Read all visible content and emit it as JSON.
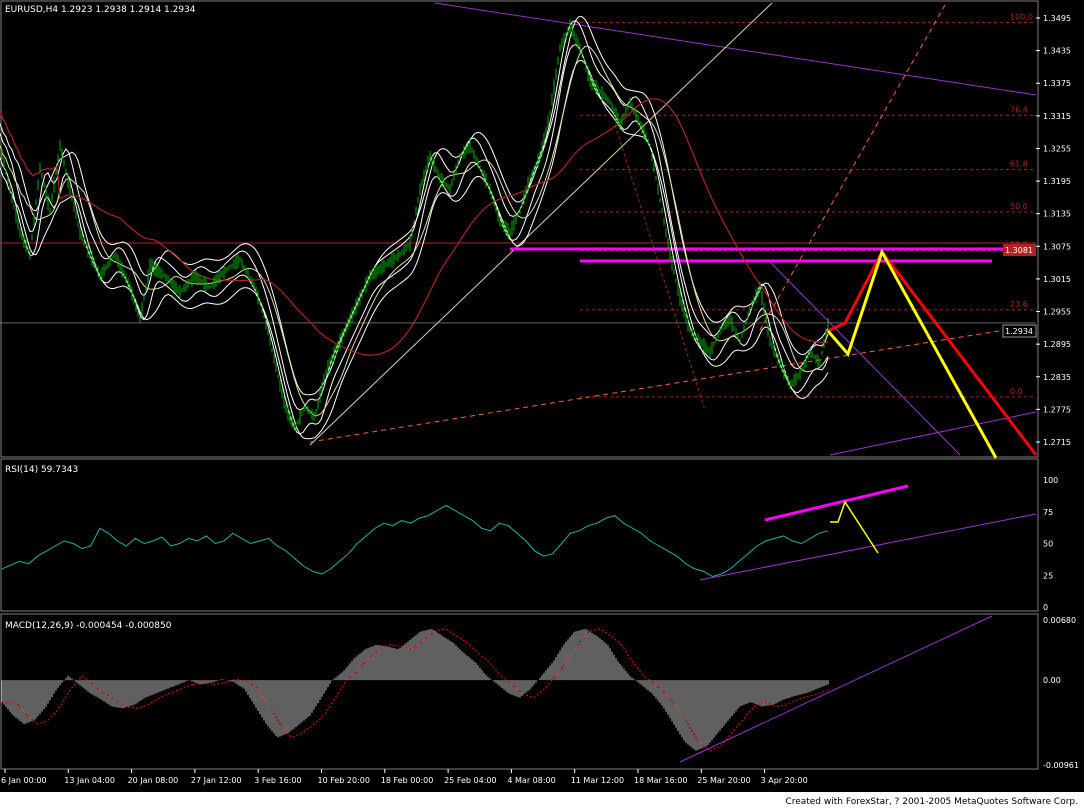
{
  "chart_title": "EURUSD,H4  1.2923 1.2938 1.2914 1.2934",
  "rsi_label": "RSI(14)  59.7343",
  "macd_label": "MACD(12,26,9)  -0.000454  -0.000850",
  "footer": "Created with ForexStar, ? 2001-2005 MetaQuotes Software Corp.",
  "current_price_label": "1.2934",
  "resistance_price_label": "1.3081",
  "colors": {
    "background": "#000000",
    "price_bars": "#00b400",
    "bands": "#ffffff",
    "ma_red": "#b22222",
    "rsi_line": "#20b2aa",
    "magenta": "#ff00ff",
    "trend_purple": "#9932cc",
    "forecast_red": "#ff0000",
    "forecast_yellow": "#ffff00",
    "fib": "#b22222",
    "macd_hist": "#c0c0c0",
    "macd_signal": "#ff0000"
  },
  "chart_data": [
    {
      "type": "line",
      "panel": "price",
      "symbol": "EURUSD",
      "timeframe": "H4",
      "ohlc_last": {
        "open": 1.2923,
        "high": 1.2938,
        "low": 1.2914,
        "close": 1.2934
      },
      "ylim": [
        1.2715,
        1.3495
      ],
      "y_ticks": [
        "1.3495",
        "1.3435",
        "1.3375",
        "1.3315",
        "1.3255",
        "1.3195",
        "1.3135",
        "1.3075",
        "1.3015",
        "1.2955",
        "1.2895",
        "1.2835",
        "1.2775",
        "1.2715"
      ],
      "x_ticks": [
        "6 Jan 00:00",
        "13 Jan 04:00",
        "20 Jan 08:00",
        "27 Jan 12:00",
        "3 Feb 16:00",
        "10 Feb 20:00",
        "18 Feb 00:00",
        "25 Feb 04:00",
        "4 Mar 08:00",
        "11 Mar 12:00",
        "18 Mar 16:00",
        "25 Mar 20:00",
        "3 Apr 20:00"
      ],
      "close_path": [
        [
          0,
          1.326
        ],
        [
          10,
          1.318
        ],
        [
          20,
          1.31
        ],
        [
          30,
          1.306
        ],
        [
          40,
          1.322
        ],
        [
          50,
          1.314
        ],
        [
          60,
          1.326
        ],
        [
          70,
          1.318
        ],
        [
          80,
          1.31
        ],
        [
          90,
          1.306
        ],
        [
          100,
          1.302
        ],
        [
          115,
          1.306
        ],
        [
          130,
          1.3
        ],
        [
          140,
          1.294
        ],
        [
          150,
          1.304
        ],
        [
          165,
          1.302
        ],
        [
          180,
          1.299
        ],
        [
          195,
          1.302
        ],
        [
          210,
          1.3
        ],
        [
          225,
          1.303
        ],
        [
          240,
          1.305
        ],
        [
          255,
          1.3
        ],
        [
          265,
          1.294
        ],
        [
          275,
          1.286
        ],
        [
          285,
          1.278
        ],
        [
          295,
          1.274
        ],
        [
          305,
          1.278
        ],
        [
          315,
          1.276
        ],
        [
          325,
          1.284
        ],
        [
          340,
          1.29
        ],
        [
          355,
          1.296
        ],
        [
          370,
          1.302
        ],
        [
          385,
          1.304
        ],
        [
          400,
          1.306
        ],
        [
          410,
          1.308
        ],
        [
          420,
          1.318
        ],
        [
          430,
          1.324
        ],
        [
          440,
          1.32
        ],
        [
          450,
          1.318
        ],
        [
          460,
          1.324
        ],
        [
          470,
          1.326
        ],
        [
          480,
          1.322
        ],
        [
          490,
          1.318
        ],
        [
          500,
          1.312
        ],
        [
          510,
          1.31
        ],
        [
          520,
          1.314
        ],
        [
          530,
          1.32
        ],
        [
          540,
          1.324
        ],
        [
          550,
          1.332
        ],
        [
          560,
          1.344
        ],
        [
          570,
          1.348
        ],
        [
          580,
          1.344
        ],
        [
          590,
          1.338
        ],
        [
          600,
          1.336
        ],
        [
          610,
          1.334
        ],
        [
          620,
          1.33
        ],
        [
          630,
          1.334
        ],
        [
          640,
          1.33
        ],
        [
          650,
          1.326
        ],
        [
          660,
          1.316
        ],
        [
          670,
          1.306
        ],
        [
          680,
          1.298
        ],
        [
          690,
          1.292
        ],
        [
          700,
          1.29
        ],
        [
          710,
          1.288
        ],
        [
          720,
          1.292
        ],
        [
          730,
          1.294
        ],
        [
          740,
          1.29
        ],
        [
          750,
          1.296
        ],
        [
          760,
          1.3
        ],
        [
          770,
          1.29
        ],
        [
          780,
          1.286
        ],
        [
          790,
          1.282
        ],
        [
          800,
          1.284
        ],
        [
          810,
          1.288
        ],
        [
          820,
          1.286
        ],
        [
          828,
          1.2934
        ]
      ],
      "fibonacci": [
        {
          "label": "100.0",
          "price": 1.3487
        },
        {
          "label": "76.4",
          "price": 1.3316
        },
        {
          "label": "61.8",
          "price": 1.3216
        },
        {
          "label": "50.0",
          "price": 1.3138
        },
        {
          "label": "38.2",
          "price": 1.3067
        },
        {
          "label": "23.6",
          "price": 1.2958
        },
        {
          "label": "0.0",
          "price": 1.2798
        }
      ],
      "resistance": 1.3081,
      "current_price": 1.2934
    },
    {
      "type": "line",
      "panel": "rsi",
      "name": "RSI(14)",
      "last_value": 59.7343,
      "ylim": [
        0,
        100
      ],
      "y_ticks": [
        "100",
        "75",
        "50",
        "25",
        "0"
      ],
      "values": [
        30,
        33,
        36,
        34,
        40,
        44,
        48,
        52,
        50,
        46,
        48,
        62,
        58,
        52,
        48,
        54,
        50,
        52,
        55,
        48,
        50,
        54,
        52,
        56,
        50,
        52,
        58,
        54,
        50,
        52,
        54,
        48,
        44,
        38,
        32,
        28,
        26,
        30,
        36,
        42,
        50,
        56,
        62,
        66,
        64,
        68,
        66,
        70,
        72,
        76,
        80,
        76,
        72,
        68,
        62,
        60,
        66,
        64,
        58,
        52,
        44,
        40,
        42,
        50,
        58,
        60,
        64,
        66,
        70,
        72,
        66,
        62,
        58,
        52,
        48,
        44,
        40,
        34,
        30,
        28,
        24,
        26,
        30,
        36,
        42,
        48,
        52,
        54,
        56,
        52,
        50,
        54,
        58,
        60
      ]
    },
    {
      "type": "bar",
      "panel": "macd",
      "name": "MACD(12,26,9)",
      "last_macd": -0.000454,
      "last_signal": -0.00085,
      "ylim": [
        -0.00961,
        0.0068
      ],
      "y_ticks": [
        "0.00680",
        "0.00",
        "-0.00961"
      ],
      "values": [
        -0.0025,
        -0.004,
        -0.005,
        -0.0045,
        -0.003,
        -0.001,
        0.0005,
        -0.0005,
        -0.0015,
        -0.0022,
        -0.003,
        -0.0032,
        -0.0028,
        -0.002,
        -0.0015,
        -0.001,
        -0.0005,
        0.0,
        -0.0005,
        -0.0003,
        0.0001,
        -0.0002,
        -0.001,
        -0.003,
        -0.005,
        -0.0065,
        -0.006,
        -0.005,
        -0.004,
        -0.002,
        0.0,
        0.001,
        0.0025,
        0.0035,
        0.004,
        0.0038,
        0.0035,
        0.0045,
        0.0055,
        0.0058,
        0.005,
        0.0042,
        0.003,
        0.002,
        0.0005,
        -0.0005,
        -0.0015,
        -0.002,
        -0.001,
        0.0005,
        0.002,
        0.004,
        0.0055,
        0.0058,
        0.005,
        0.004,
        0.002,
        0.0005,
        -0.0005,
        -0.0015,
        -0.003,
        -0.005,
        -0.007,
        -0.008,
        -0.0075,
        -0.006,
        -0.0045,
        -0.003,
        -0.0025,
        -0.003,
        -0.0028,
        -0.0022,
        -0.0018,
        -0.0015,
        -0.001,
        -0.0005
      ]
    }
  ]
}
